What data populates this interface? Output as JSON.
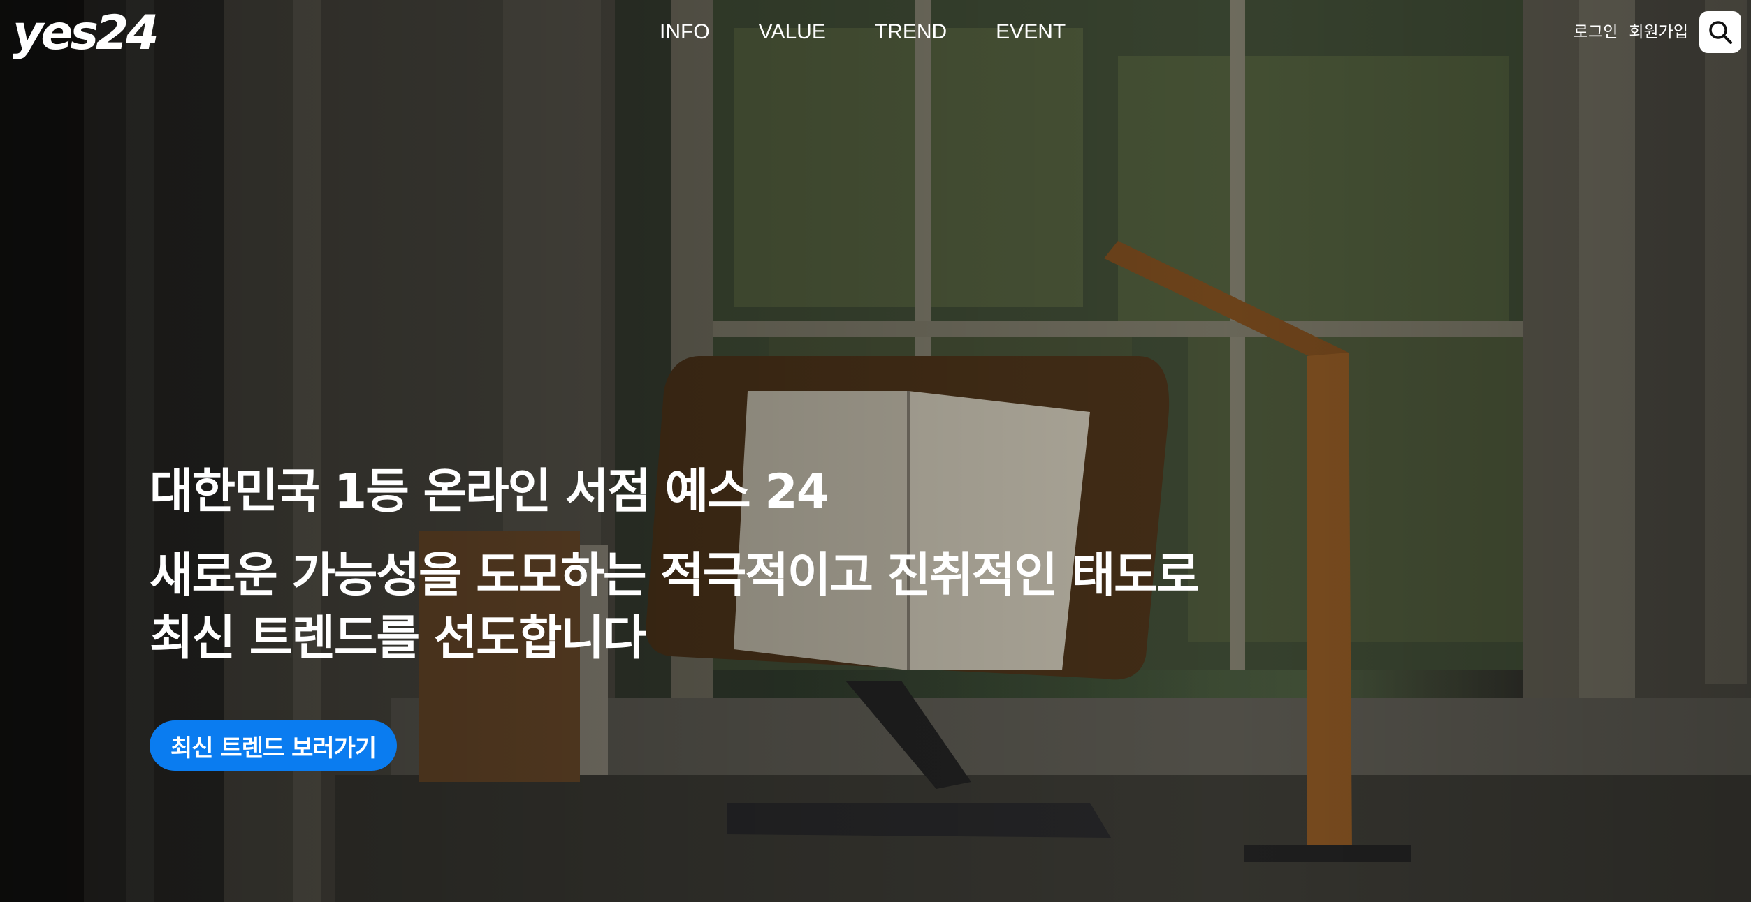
{
  "header": {
    "logo_text": "yes24",
    "nav": [
      {
        "label": "INFO"
      },
      {
        "label": "VALUE"
      },
      {
        "label": "TREND"
      },
      {
        "label": "EVENT"
      }
    ],
    "auth": {
      "login_label": "로그인",
      "signup_label": "회원가입"
    },
    "search_icon": "search-icon"
  },
  "hero": {
    "headline": "대한민국 1등 온라인 서점 예스 24",
    "subline_1": "새로운 가능성을 도모하는 적극적이고 진취적인 태도로",
    "subline_2": "최신 트렌드를 선도합니다",
    "cta_label": "최신 트렌드 보러가기",
    "background_image": "window-reading-stand-photo"
  },
  "colors": {
    "accent": "#0a7cf0",
    "text": "#ffffff"
  }
}
